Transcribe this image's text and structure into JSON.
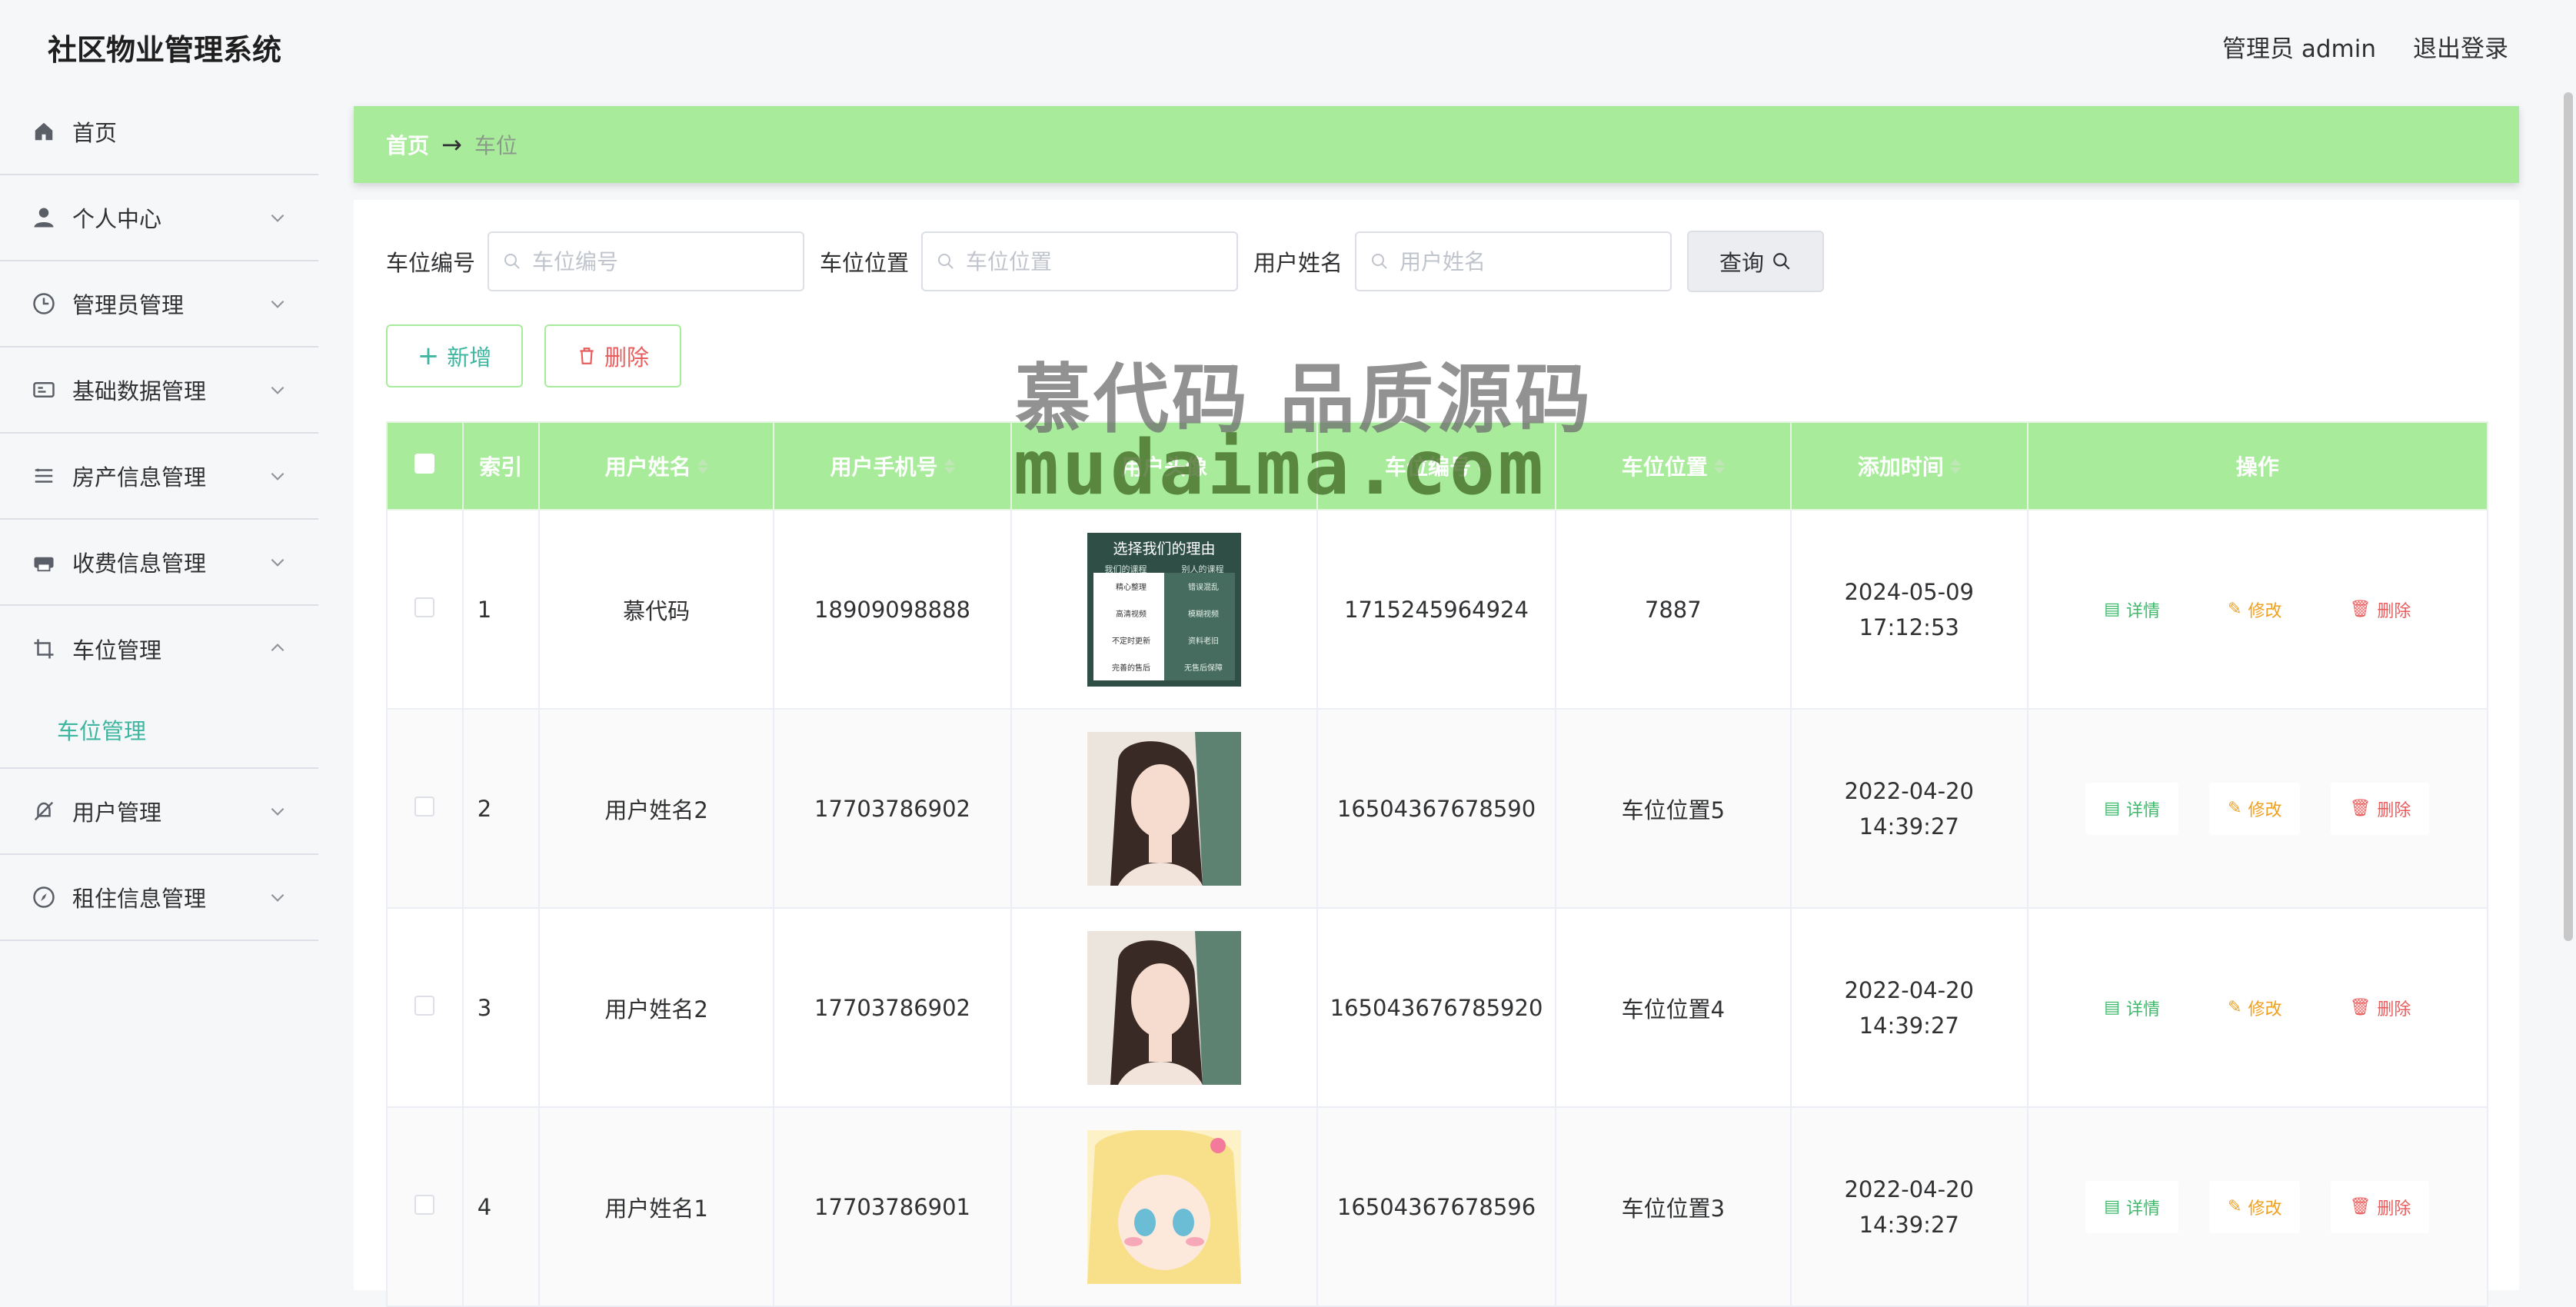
{
  "header": {
    "app_title": "社区物业管理系统",
    "user_label": "管理员 admin",
    "logout_label": "退出登录"
  },
  "sidebar": {
    "items": [
      {
        "label": "首页",
        "icon": "home-icon"
      },
      {
        "label": "个人中心",
        "icon": "user-icon"
      },
      {
        "label": "管理员管理",
        "icon": "clock-icon"
      },
      {
        "label": "基础数据管理",
        "icon": "card-icon"
      },
      {
        "label": "房产信息管理",
        "icon": "list-icon"
      },
      {
        "label": "收费信息管理",
        "icon": "printer-icon"
      },
      {
        "label": "车位管理",
        "icon": "crop-icon"
      },
      {
        "label": "用户管理",
        "icon": "bell-off-icon"
      },
      {
        "label": "租住信息管理",
        "icon": "compass-icon"
      }
    ],
    "sub_item": "车位管理"
  },
  "breadcrumb": {
    "home": "首页",
    "arrow": "→",
    "current": "车位"
  },
  "search": {
    "f1_label": "车位编号",
    "f1_placeholder": "车位编号",
    "f2_label": "车位位置",
    "f2_placeholder": "车位位置",
    "f3_label": "用户姓名",
    "f3_placeholder": "用户姓名",
    "query_label": "查询"
  },
  "actions": {
    "add_label": "新增",
    "delete_label": "删除"
  },
  "table": {
    "headers": [
      "索引",
      "用户姓名",
      "用户手机号",
      "用户头像",
      "车位编号",
      "车位位置",
      "添加时间",
      "操作"
    ],
    "op_labels": {
      "detail": "详情",
      "edit": "修改",
      "remove": "删除"
    },
    "rows": [
      {
        "index": "1",
        "name": "慕代码",
        "phone": "18909098888",
        "code": "1715245964924",
        "location": "7887",
        "time": "2024-05-09 17:12:53"
      },
      {
        "index": "2",
        "name": "用户姓名2",
        "phone": "17703786902",
        "code": "16504367678590",
        "location": "车位位置5",
        "time": "2022-04-20 14:39:27"
      },
      {
        "index": "3",
        "name": "用户姓名2",
        "phone": "17703786902",
        "code": "165043676785920",
        "location": "车位位置4",
        "time": "2022-04-20 14:39:27"
      },
      {
        "index": "4",
        "name": "用户姓名1",
        "phone": "17703786901",
        "code": "16504367678596",
        "location": "车位位置3",
        "time": "2022-04-20 14:39:27"
      }
    ]
  },
  "avatar_card": {
    "title": "选择我们的理由",
    "left_head": "我们的课程",
    "right_head": "别人的课程",
    "left": [
      "精心整理",
      "高清视频",
      "不定时更新",
      "完善的售后"
    ],
    "right": [
      "错误混乱",
      "模糊视频",
      "资料老旧",
      "无售后保障"
    ]
  },
  "watermark": {
    "line1": "慕代码 品质源码",
    "line2": "mudaima.com"
  },
  "colors": {
    "accent": "#a8ec9b",
    "teal": "#3eb6a0",
    "danger": "#e85d5d",
    "warning": "#f0a020",
    "success": "#3eb86a"
  }
}
